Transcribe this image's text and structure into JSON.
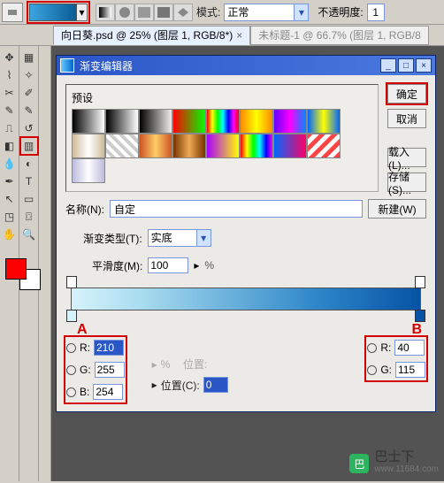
{
  "toolbar": {
    "mode_label": "模式:",
    "mode_value": "正常",
    "opacity_label": "不透明度:",
    "opacity_value": "1"
  },
  "tabs": [
    {
      "label": "向日葵.psd @ 25% (图层 1, RGB/8*)",
      "active": true
    },
    {
      "label": "未标题-1 @ 66.7% (图层 1, RGB/8",
      "active": false
    }
  ],
  "dialog": {
    "title": "渐变编辑器",
    "preset_label": "预设",
    "buttons": {
      "ok": "确定",
      "cancel": "取消",
      "load": "载入(L)...",
      "save": "存储(S)..."
    },
    "name_label": "名称(N):",
    "name_value": "自定",
    "new_btn": "新建(W)",
    "grad_type_label": "渐变类型(T):",
    "grad_type_value": "实底",
    "smoothness_label": "平滑度(M):",
    "smoothness_value": "100",
    "pointA": {
      "label": "A",
      "R": "210",
      "G": "255",
      "B": "254"
    },
    "pointB": {
      "label": "B",
      "R": "40",
      "G": "115"
    },
    "location_label": "位置(C):",
    "location_value": "0",
    "position_label": "位置:",
    "percent": "%"
  },
  "watermark": {
    "line1": "巴士下",
    "line2": "www.11684.com"
  },
  "swatches": [
    "linear-gradient(90deg,#000,#fff)",
    "linear-gradient(90deg,#000,#fff)",
    "linear-gradient(90deg,#000,transparent)",
    "linear-gradient(90deg,#f00,#0f0)",
    "linear-gradient(90deg,#f00,#ff0,#0f0,#0ff,#00f,#f0f,#f00)",
    "linear-gradient(90deg,#f80,#ff0,#f80)",
    "linear-gradient(90deg,#60f,#f0f,#08f)",
    "linear-gradient(90deg,#06f,#ff0,#06f)",
    "linear-gradient(90deg,#cb9,#fff,#cb9)",
    "repeating-linear-gradient(45deg,#fff,#fff 4px,#ccc 4px,#ccc 8px)",
    "linear-gradient(90deg,#c52,#fc6,#c52)",
    "linear-gradient(90deg,#730,#ea5,#730)",
    "linear-gradient(90deg,#a0f,#ff0)",
    "linear-gradient(90deg,#f00,#ff0,#0f0,#0ff,#00f,#f0f)",
    "linear-gradient(90deg,#06f,#f06)",
    "repeating-linear-gradient(-45deg,#f44,#f44 5px,#fff 5px,#fff 10px)",
    "linear-gradient(90deg,#bbd,#fff,#bbd)"
  ]
}
